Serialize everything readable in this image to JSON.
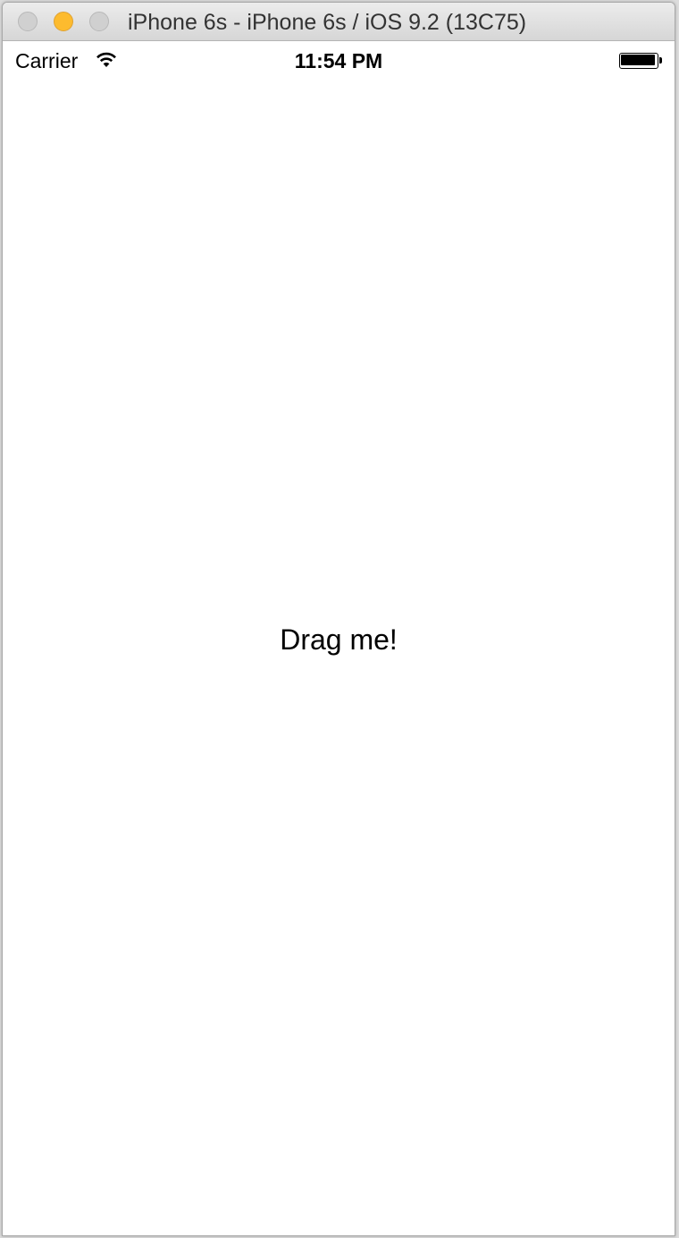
{
  "window": {
    "title": "iPhone 6s - iPhone 6s / iOS 9.2 (13C75)",
    "controls": {
      "close": "close-button",
      "minimize": "minimize-button",
      "zoom": "zoom-button"
    },
    "colors": {
      "minimize": "#fdbb2e",
      "inactive": "#d0d0d0"
    }
  },
  "status_bar": {
    "carrier": "Carrier",
    "wifi_icon": "wifi-icon",
    "time": "11:54 PM",
    "battery_icon": "battery-icon",
    "battery_level": 1.0
  },
  "content": {
    "drag_label": "Drag me!"
  }
}
